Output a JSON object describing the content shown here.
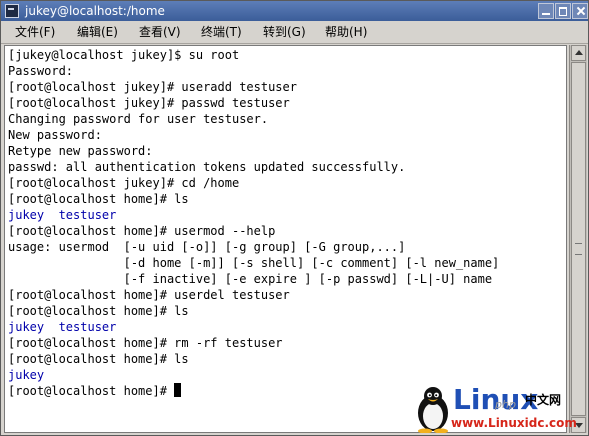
{
  "window": {
    "title": "jukey@localhost:/home"
  },
  "menu": [
    {
      "label": "文件(F)"
    },
    {
      "label": "编辑(E)"
    },
    {
      "label": "查看(V)"
    },
    {
      "label": "终端(T)"
    },
    {
      "label": "转到(G)"
    },
    {
      "label": "帮助(H)"
    }
  ],
  "terminal": {
    "lines": [
      "[jukey@localhost jukey]$ su root",
      "Password:",
      "[root@localhost jukey]# useradd testuser",
      "[root@localhost jukey]# passwd testuser",
      "Changing password for user testuser.",
      "New password:",
      "Retype new password:",
      "passwd: all authentication tokens updated successfully.",
      "[root@localhost jukey]# cd /home",
      "[root@localhost home]# ls",
      "jukey  testuser",
      "[root@localhost home]# usermod --help",
      "usage: usermod  [-u uid [-o]] [-g group] [-G group,...]",
      "                [-d home [-m]] [-s shell] [-c comment] [-l new_name]",
      "                [-f inactive] [-e expire ] [-p passwd] [-L|-U] name",
      "[root@localhost home]# userdel testuser",
      "[root@localhost home]# ls",
      "jukey  testuser",
      "[root@localhost home]# rm -rf testuser",
      "[root@localhost home]# ls",
      "jukey",
      "[root@localhost home]# "
    ],
    "colors": {
      "text": "#000000",
      "dir_listing": "#0000aa",
      "background": "#ffffff"
    }
  },
  "watermark": {
    "logo": "Linux",
    "cn": "中文网",
    "php": "php",
    "url": "www.Linuxidc.com"
  }
}
